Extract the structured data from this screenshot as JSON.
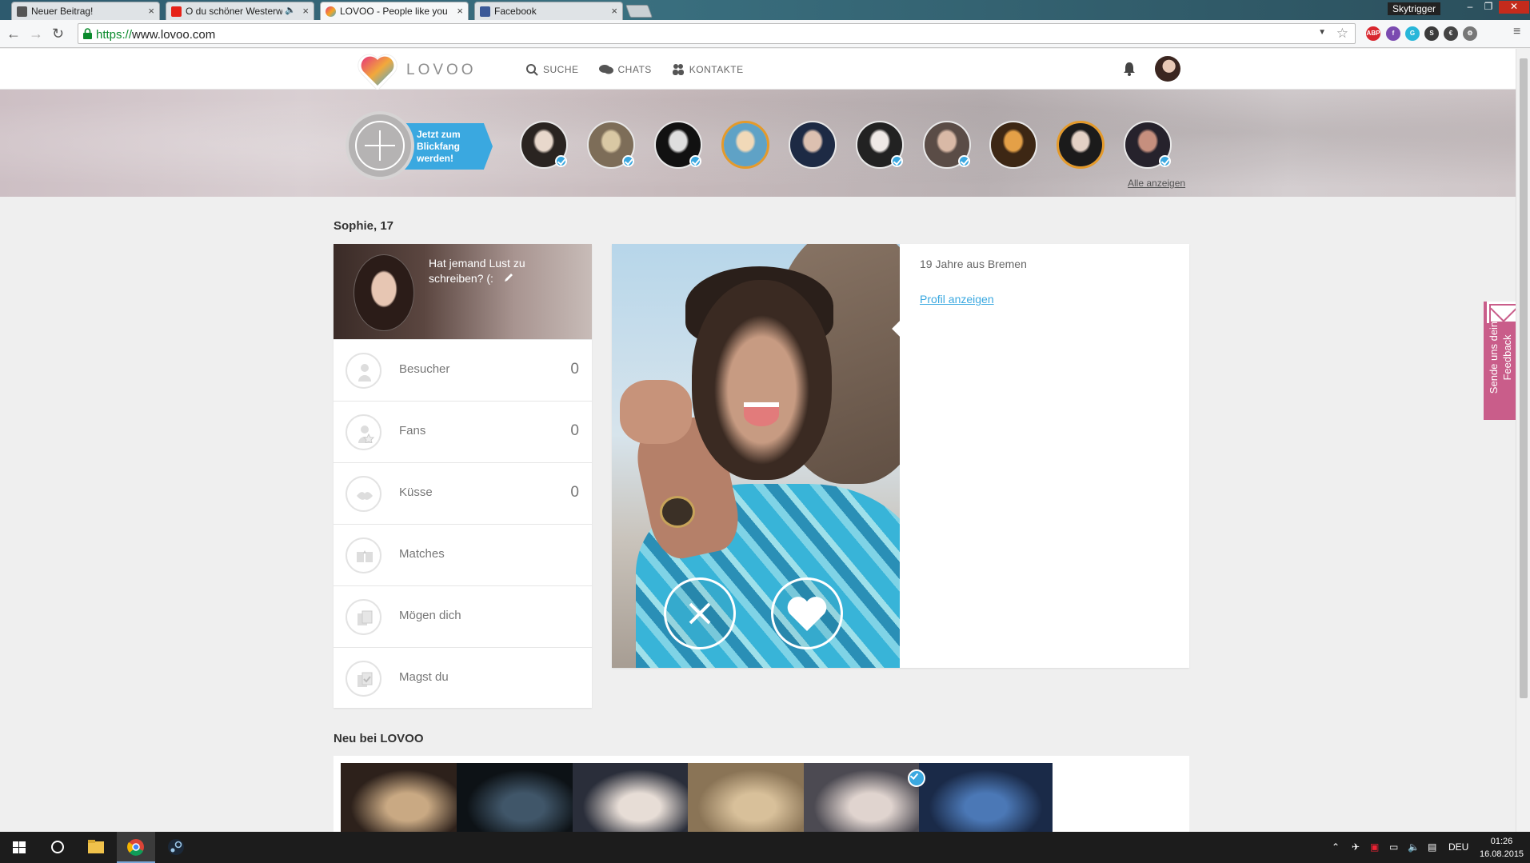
{
  "browser": {
    "tabs": [
      {
        "title": "Neuer Beitrag!",
        "favicon_color": "#555555"
      },
      {
        "title": "O du schöner Westerw",
        "favicon_color": "#e62117"
      },
      {
        "title": "LOVOO - People like you",
        "favicon_color": "#e6357a"
      },
      {
        "title": "Facebook",
        "favicon_color": "#3b5998"
      }
    ],
    "url_scheme": "https://",
    "url_host": "www.lovoo.com",
    "profile_name": "Skytrigger",
    "extensions": [
      {
        "name": "adblock-extension",
        "label": "ABP",
        "color": "#d8262e"
      },
      {
        "name": "purple-extension",
        "label": "f",
        "color": "#7b4bb0"
      },
      {
        "name": "cyan-extension",
        "label": "G",
        "color": "#28b6d9"
      },
      {
        "name": "s-extension",
        "label": "S",
        "color": "#3a3a3a"
      },
      {
        "name": "euro-extension",
        "label": "€",
        "color": "#444444"
      },
      {
        "name": "globe-extension",
        "label": "⚙",
        "color": "#777777"
      }
    ]
  },
  "site": {
    "logo_text": "LOVOO",
    "nav": {
      "search": "SUCHE",
      "chats": "CHATS",
      "contacts": "KONTAKTE"
    }
  },
  "blickfang": {
    "label": "Jetzt zum Blickfang werden!",
    "show_all": "Alle anzeigen",
    "thumbs": [
      {
        "verified": true,
        "gold": false,
        "colors": [
          "#e8d8cc",
          "#2a2421"
        ]
      },
      {
        "verified": true,
        "gold": false,
        "colors": [
          "#d9c8a4",
          "#7d6d58"
        ]
      },
      {
        "verified": true,
        "gold": false,
        "colors": [
          "#dedede",
          "#111111"
        ]
      },
      {
        "verified": false,
        "gold": true,
        "colors": [
          "#f1d9b8",
          "#5fa2c6"
        ]
      },
      {
        "verified": false,
        "gold": false,
        "colors": [
          "#dcc0b0",
          "#1d2a44"
        ]
      },
      {
        "verified": true,
        "gold": false,
        "colors": [
          "#efe9e6",
          "#222222"
        ]
      },
      {
        "verified": true,
        "gold": false,
        "colors": [
          "#d9b9a6",
          "#5a4c46"
        ]
      },
      {
        "verified": false,
        "gold": false,
        "colors": [
          "#e4a047",
          "#3d2714"
        ]
      },
      {
        "verified": false,
        "gold": true,
        "colors": [
          "#e3d1c5",
          "#1b1b1b"
        ]
      },
      {
        "verified": true,
        "gold": false,
        "colors": [
          "#c68f7e",
          "#26222c"
        ]
      }
    ]
  },
  "me": {
    "name_age": "Sophie, 17",
    "status": "Hat jemand Lust zu schreiben? (:",
    "stats": [
      {
        "key": "visitors",
        "label": "Besucher",
        "value": "0"
      },
      {
        "key": "fans",
        "label": "Fans",
        "value": "0"
      },
      {
        "key": "kisses",
        "label": "Küsse",
        "value": "0"
      },
      {
        "key": "matches",
        "label": "Matches",
        "value": ""
      },
      {
        "key": "likes-you",
        "label": "Mögen dich",
        "value": ""
      },
      {
        "key": "you-like",
        "label": "Magst du",
        "value": ""
      }
    ]
  },
  "match": {
    "age_city": "19 Jahre aus Bremen",
    "profile_link": "Profil anzeigen"
  },
  "new": {
    "title": "Neu bei LOVOO",
    "pics": [
      {
        "verified": false,
        "colors": [
          "#c9a983",
          "#2d211b"
        ]
      },
      {
        "verified": false,
        "colors": [
          "#405669",
          "#0d1216"
        ]
      },
      {
        "verified": false,
        "colors": [
          "#e7ddd6",
          "#2a2e3a"
        ]
      },
      {
        "verified": false,
        "colors": [
          "#d8c09a",
          "#8a7456"
        ]
      },
      {
        "verified": true,
        "colors": [
          "#e0d4cf",
          "#4c4a52"
        ]
      },
      {
        "verified": false,
        "colors": [
          "#4b78b6",
          "#1a2a48"
        ]
      }
    ]
  },
  "feedback": {
    "label": "Sende uns dein Feedback"
  },
  "taskbar": {
    "language": "DEU",
    "time": "01:26",
    "date": "16.08.2015"
  }
}
